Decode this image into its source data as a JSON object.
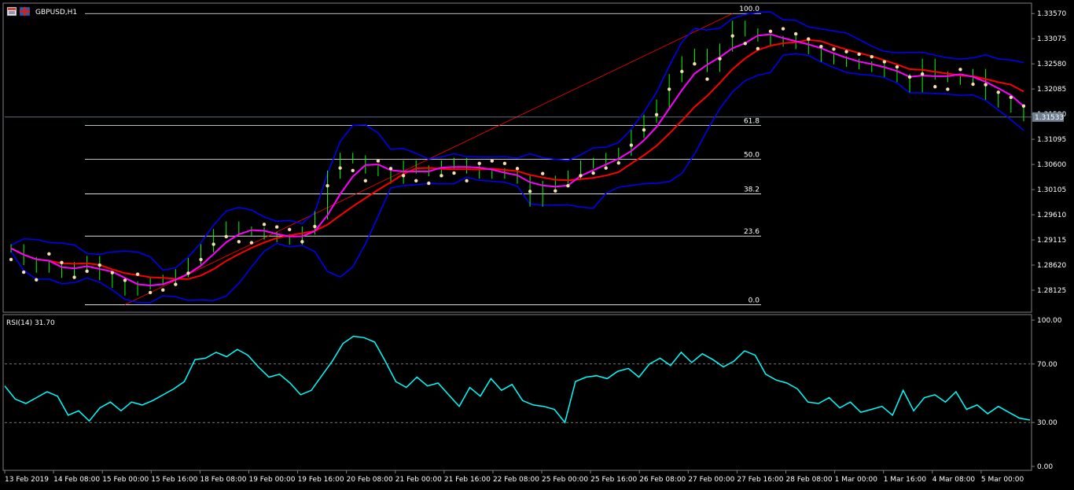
{
  "window": {
    "symbol_label": "GBPUSD,H1",
    "rsi_label": "RSI(14) 31.70"
  },
  "colors": {
    "background": "#000000",
    "grid": "#ffffff",
    "candle_up": "#00ff00",
    "candle_down": "#00ff00",
    "bollinger": "#0000ff",
    "ma_fast": "#ff00ff",
    "ma_slow": "#ff0000",
    "parabolic_sar": "#f5deb3",
    "rsi_line": "#00ffff",
    "fib_lines": "#ffffff",
    "trendline": "#ff0000",
    "current_price_line": "#708090"
  },
  "icons": [
    "chart-window-icon",
    "symbol-flag-icon"
  ],
  "chart_data": [
    {
      "type": "candlestick",
      "title": "GBPUSD,H1",
      "price_axis": {
        "ticks": [
          "1.33570",
          "1.33075",
          "1.32580",
          "1.32085",
          "1.31590",
          "1.31095",
          "1.30600",
          "1.30105",
          "1.29610",
          "1.29115",
          "1.28620",
          "1.28125"
        ],
        "ylim": [
          1.278,
          1.3362
        ],
        "current_price": "1.31533"
      },
      "time_axis": {
        "labels": [
          "13 Feb 2019",
          "14 Feb 08:00",
          "15 Feb 00:00",
          "15 Feb 16:00",
          "18 Feb 08:00",
          "19 Feb 00:00",
          "19 Feb 16:00",
          "20 Feb 08:00",
          "21 Feb 00:00",
          "21 Feb 16:00",
          "22 Feb 08:00",
          "25 Feb 00:00",
          "25 Feb 16:00",
          "26 Feb 08:00",
          "27 Feb 00:00",
          "27 Feb 16:00",
          "28 Feb 08:00",
          "1 Mar 00:00",
          "1 Mar 16:00",
          "4 Mar 08:00",
          "5 Mar 00:00"
        ]
      },
      "close_series": [
        1.2895,
        1.287,
        1.2855,
        1.2862,
        1.2845,
        1.286,
        1.2872,
        1.284,
        1.2825,
        1.281,
        1.2822,
        1.283,
        1.2835,
        1.2846,
        1.2868,
        1.2895,
        1.2925,
        1.294,
        1.293,
        1.2928,
        1.292,
        1.2915,
        1.291,
        1.293,
        1.296,
        1.304,
        1.3075,
        1.307,
        1.305,
        1.3045,
        1.303,
        1.306,
        1.305,
        1.3045,
        1.306,
        1.3065,
        1.305,
        1.304,
        1.3045,
        1.304,
        1.303,
        1.2985,
        1.302,
        1.303,
        1.304,
        1.306,
        1.3065,
        1.3075,
        1.3085,
        1.312,
        1.315,
        1.318,
        1.323,
        1.3265,
        1.328,
        1.325,
        1.329,
        1.3335,
        1.332,
        1.331,
        1.33,
        1.3305,
        1.3295,
        1.3285,
        1.327,
        1.3265,
        1.326,
        1.3255,
        1.325,
        1.324,
        1.323,
        1.321,
        1.326,
        1.3235,
        1.323,
        1.3225,
        1.324,
        1.3195,
        1.318,
        1.317,
        1.3153
      ],
      "fibonacci": {
        "levels": [
          "100.0",
          "61.8",
          "50.0",
          "38.2",
          "23.6",
          "0.0"
        ],
        "prices": [
          1.3357,
          1.3137,
          1.307,
          1.3002,
          1.2919,
          1.2784
        ]
      }
    },
    {
      "type": "line",
      "title": "RSI(14) 31.70",
      "ylim": [
        0,
        100
      ],
      "ticks": [
        "100.00",
        "70.00",
        "30.00",
        "0.00"
      ],
      "levels": [
        70,
        30
      ],
      "values": [
        55,
        46,
        43,
        47,
        51,
        48,
        35,
        38,
        31,
        40,
        44,
        38,
        44,
        42,
        45,
        49,
        53,
        58,
        73,
        74,
        78,
        75,
        80,
        76,
        68,
        61,
        63,
        57,
        49,
        52,
        62,
        72,
        84,
        89,
        88,
        85,
        72,
        58,
        54,
        61,
        55,
        57,
        49,
        41,
        54,
        48,
        60,
        52,
        56,
        45,
        42,
        41,
        39,
        30,
        58,
        61,
        62,
        60,
        65,
        67,
        61,
        70,
        74,
        69,
        78,
        71,
        77,
        73,
        68,
        72,
        79,
        76,
        63,
        59,
        57,
        53,
        44,
        43,
        47,
        40,
        44,
        37,
        39,
        41,
        35,
        52,
        38,
        47,
        49,
        44,
        51,
        39,
        42,
        36,
        41,
        37,
        33,
        31.7
      ]
    }
  ]
}
